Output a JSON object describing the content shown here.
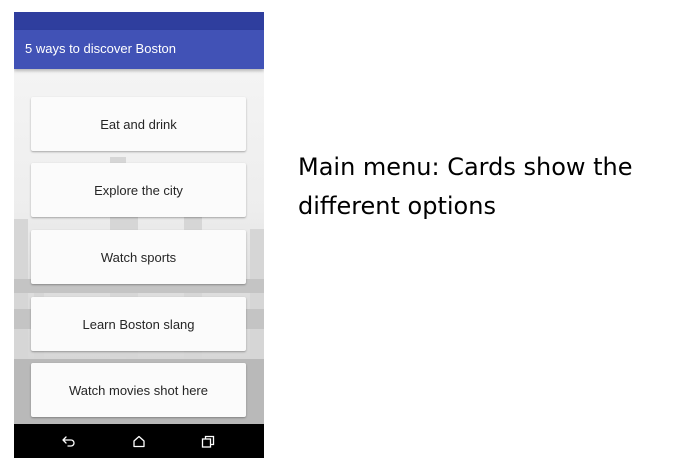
{
  "app": {
    "title": "5 ways to discover Boston"
  },
  "menu": {
    "cards": [
      {
        "label": "Eat and drink"
      },
      {
        "label": "Explore the city"
      },
      {
        "label": "Watch sports"
      },
      {
        "label": "Learn Boston slang"
      },
      {
        "label": "Watch movies shot here"
      }
    ]
  },
  "nav": {
    "icons": [
      "back-icon",
      "home-icon",
      "recents-icon"
    ]
  },
  "caption": {
    "text": "Main menu: Cards show the different options"
  },
  "colors": {
    "status_bar": "#2f3e9e",
    "app_bar": "#4152b6",
    "nav_bar": "#000000",
    "card": "#fbfbfb"
  }
}
